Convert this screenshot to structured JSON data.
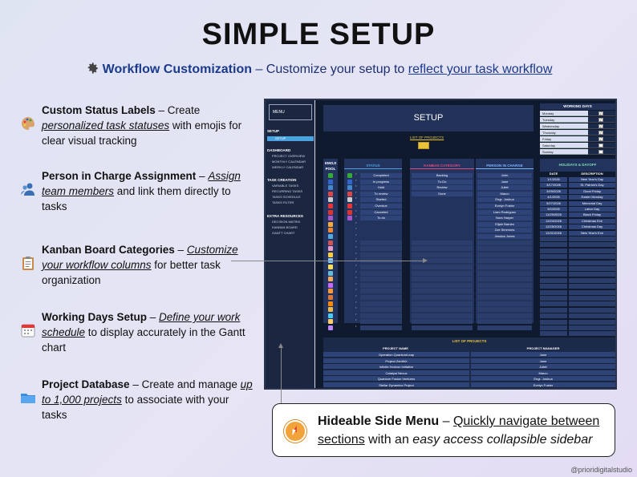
{
  "header": {
    "title": "SIMPLE SETUP",
    "sub_bold": "Workflow Customization",
    "sub_dash": " – Customize your setup to ",
    "sub_link": "reflect your task workflow"
  },
  "features": [
    {
      "icon": "palette-icon",
      "title": "Custom Status Labels",
      "dash": " – Create ",
      "em": "personalized task statuses",
      "rest": " with emojis for clear visual tracking"
    },
    {
      "icon": "person-icon",
      "title": "Person in Charge Assignment",
      "dash": " – ",
      "em": "Assign team members",
      "rest": " and link them directly to tasks"
    },
    {
      "icon": "clipboard-icon",
      "title": "Kanban Board Categories",
      "dash": " – ",
      "em": "Customize your workflow columns",
      "rest": " for better task organization"
    },
    {
      "icon": "calendar-icon",
      "title": "Working Days Setup",
      "dash": " – ",
      "em": "Define your work schedule",
      "rest": " to display accurately in the Gantt chart"
    },
    {
      "icon": "folder-icon",
      "title": "Project Database",
      "dash": " – Create and manage ",
      "em": "up to 1,000 projects",
      "rest": " to associate with your tasks"
    }
  ],
  "screenshot": {
    "menu": "MENU",
    "setup_section": "SETUP",
    "setup_item": "SETUP",
    "dashboard_section": "DASHBOARD",
    "dashboard_items": [
      "PROJECT OVERVIEW",
      "MONTHLY CALENDAR",
      "WEEKLY CALENDAR"
    ],
    "task_section": "TASK CREATION",
    "task_items": [
      "VARIABLE TASKS",
      "RECURRING TASKS",
      "TASKS SCHEDULE",
      "TASKS FILTER"
    ],
    "extra_section": "EXTRA RESOURCES",
    "extra_items": [
      "DECISION MATRIX",
      "KANBAN BOARD",
      "GANTT CHART"
    ],
    "title": "SETUP",
    "list_of_projects_link": "LIST OF PROJECTS",
    "headers": {
      "emoji_pool": "EMOJI POOL",
      "status": "STATUS",
      "kanban": "KANBAN CATEGORY",
      "person": "PERSON IN CHARGE"
    },
    "statuses": [
      "Completed",
      "In progress",
      "Hold",
      "To review",
      "Started",
      "Overdue",
      "Canceled",
      "To do"
    ],
    "kanban": [
      "Backlog",
      "To-Do",
      "Review",
      "Done"
    ],
    "persons": [
      "John",
      "Jane",
      "Juliet",
      "Marco",
      "Engr. Joshua",
      "Evelyn Foster",
      "Liam Rodriguez",
      "Nora Harper",
      "Elijah Barnes",
      "Zoe Simmons",
      "Jessica Jones"
    ],
    "working_days_title": "WORKING DAYS",
    "working_days": [
      {
        "day": "Monday",
        "check": "✓"
      },
      {
        "day": "Tuesday",
        "check": "✓"
      },
      {
        "day": "Wednesday",
        "check": "✓"
      },
      {
        "day": "Thursday",
        "check": "✓"
      },
      {
        "day": "Friday",
        "check": "✓"
      },
      {
        "day": "Saturday",
        "check": ""
      },
      {
        "day": "Sunday",
        "check": ""
      }
    ],
    "holidays_title": "HOLIDAYS & DAYOFF",
    "holiday_headers": {
      "date": "DATE",
      "desc": "DESCRIPTION"
    },
    "holidays": [
      {
        "date": "1/1/2026",
        "desc": "New Year's Day"
      },
      {
        "date": "3/17/2026",
        "desc": "St. Patrick's Day"
      },
      {
        "date": "3/29/2026",
        "desc": "Good Friday"
      },
      {
        "date": "4/1/2026",
        "desc": "Easter Monday"
      },
      {
        "date": "5/27/2026",
        "desc": "Memorial Day"
      },
      {
        "date": "9/2/2026",
        "desc": "Labor Day"
      },
      {
        "date": "11/29/2026",
        "desc": "Black Friday"
      },
      {
        "date": "12/24/2026",
        "desc": "Christmas Eve"
      },
      {
        "date": "12/25/2026",
        "desc": "Christmas Day"
      },
      {
        "date": "12/31/2026",
        "desc": "New Year's Eve"
      }
    ],
    "projects_title": "LIST OF PROJECTS",
    "project_headers": {
      "name": "PROJECT NAME",
      "manager": "PROJECT MANAGER"
    },
    "projects": [
      {
        "name": "Operation QuantumLeap",
        "manager": "Jane"
      },
      {
        "name": "Project ZenithX",
        "manager": "Jane"
      },
      {
        "name": "Infinite Horizon Initiative",
        "manager": "Juliet"
      },
      {
        "name": "Catalyst Nexus",
        "manager": "Marco"
      },
      {
        "name": "Quantum Fusion Ventures",
        "manager": "Engr. Joshua"
      },
      {
        "name": "Stellar Dynamics Project",
        "manager": "Evelyn Foster"
      }
    ]
  },
  "callout": {
    "title": "Hideable Side Menu",
    "dash": " – ",
    "link": "Quickly navigate between sections",
    "mid": " with an ",
    "em": "easy access collapsible sidebar"
  },
  "footer": "@prioridigitalstudio",
  "colors": {
    "accent": "#1b3a8c",
    "status_header": "#4aa3df",
    "kanban_header": "#e04a7a",
    "person_header": "#7ab3ff",
    "holiday_header": "#7fe0b4",
    "projects_header": "#e9c43a"
  }
}
